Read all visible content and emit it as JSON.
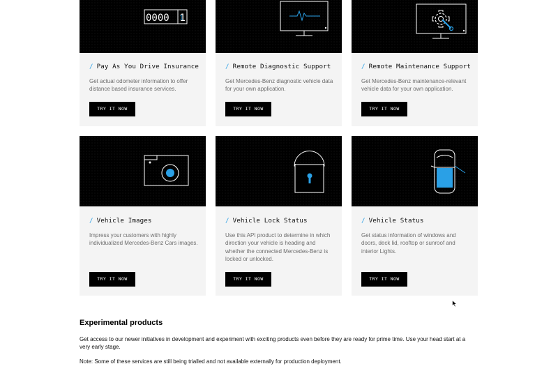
{
  "cards": [
    {
      "title": "Pay As You Drive Insurance",
      "description": "Get actual odometer information to offer distance based insurance services.",
      "button": "TRY IT NOW",
      "icon": "odometer-icon",
      "odometer_digits": "0000",
      "odometer_last": "1"
    },
    {
      "title": "Remote Diagnostic Support",
      "description": "Get Mercedes-Benz diagnostic vehicle data for your own application.",
      "button": "TRY IT NOW",
      "icon": "monitor-heartbeat-icon"
    },
    {
      "title": "Remote Maintenance Support",
      "description": "Get Mercedes-Benz maintenance-relevant vehicle data for your own application.",
      "button": "TRY IT NOW",
      "icon": "monitor-gear-wrench-icon"
    },
    {
      "title": "Vehicle Images",
      "description": "Impress your customers with highly individualized Mercedes-Benz Cars images.",
      "button": "TRY IT NOW",
      "icon": "camera-icon"
    },
    {
      "title": "Vehicle Lock Status",
      "description": "Use this API product to determine in which direction your vehicle is heading and whether the connected Mercedes-Benz is locked or unlocked.",
      "button": "TRY IT NOW",
      "icon": "padlock-icon"
    },
    {
      "title": "Vehicle Status",
      "description": "Get status information of windows and doors, deck lid, rooftop or sunroof and interior Lights.",
      "button": "TRY IT NOW",
      "icon": "car-top-view-icon"
    }
  ],
  "experimental": {
    "heading": "Experimental products",
    "paragraph": "Get access to our newer initiatives in development and experiment with exciting products even before they are ready for prime time. Use your head start at a very early stage.",
    "note": "Note: Some of these services are still being trialled and not available externally for production deployment."
  },
  "colors": {
    "accent": "#2aa0e6",
    "card_background": "#f4f4f4",
    "media_background": "#000000",
    "button_background": "#000000"
  }
}
